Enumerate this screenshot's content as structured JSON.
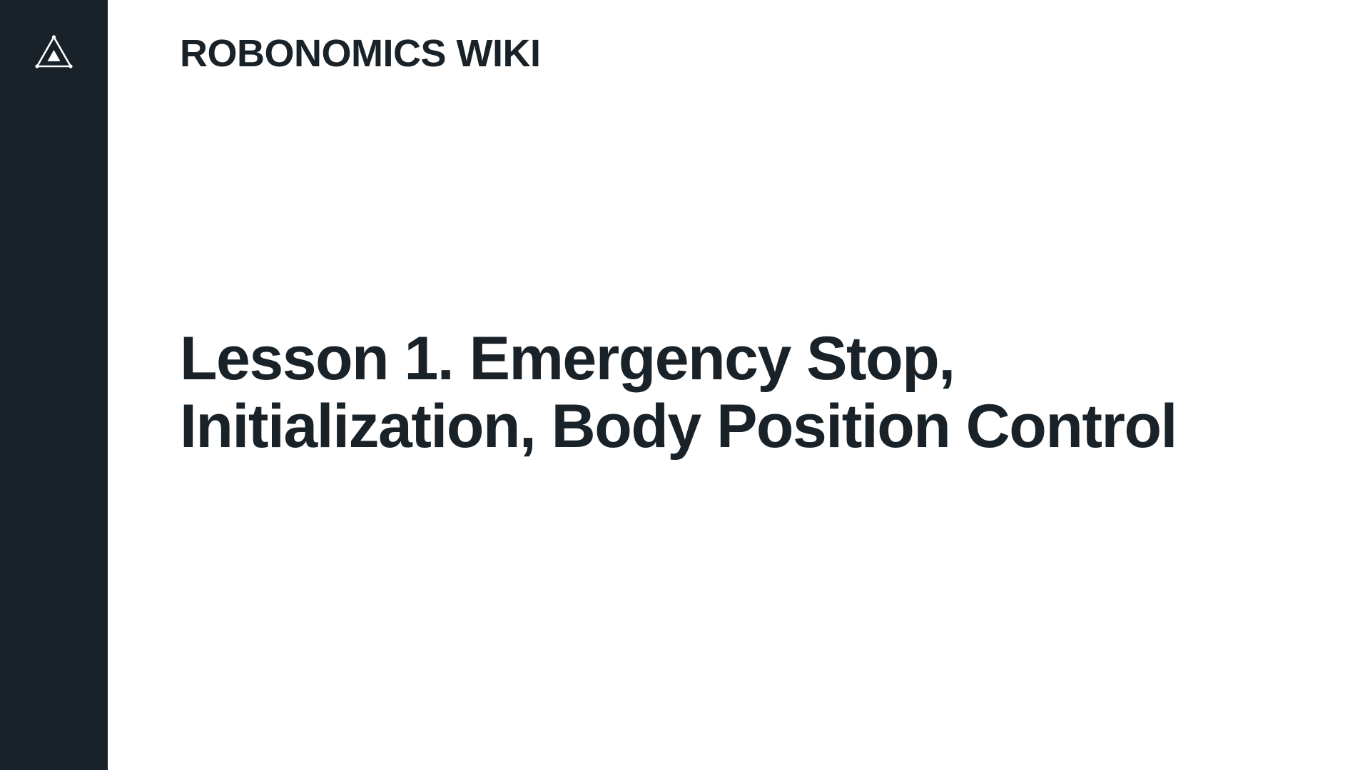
{
  "sidebar": {
    "logo_icon": "robonomics-triangle-icon",
    "background": "#192228"
  },
  "header": {
    "site_title": "ROBONOMICS WIKI"
  },
  "main": {
    "title_line_1": "Lesson 1. Emergency Stop,",
    "title_line_2": "Initialization, Body Position Control"
  },
  "colors": {
    "text": "#192228",
    "background": "#ffffff",
    "sidebar": "#192228"
  }
}
